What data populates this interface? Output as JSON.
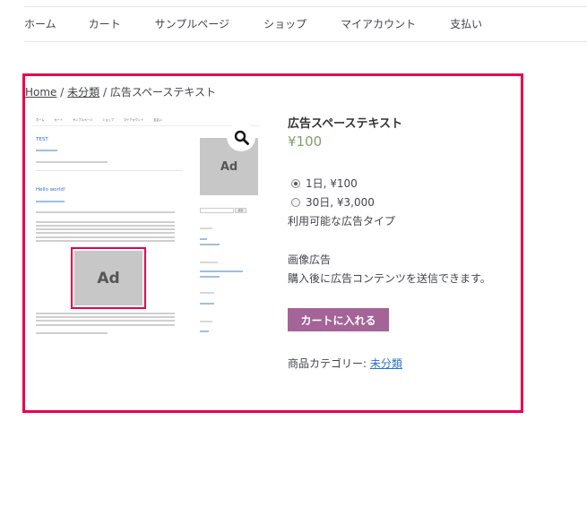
{
  "nav": {
    "items": [
      "ホーム",
      "カート",
      "サンプルページ",
      "ショップ",
      "マイアカウント",
      "支払い"
    ]
  },
  "breadcrumb": {
    "home": "Home",
    "category": "未分類",
    "current": "広告スペーステキスト",
    "separator": "/"
  },
  "gallery": {
    "mini_nav": [
      "ホーム",
      "カート",
      "サンプルページ",
      "ショップ",
      "マイアカウント",
      "支払い"
    ],
    "post1_title": "TEST",
    "post2_title": "Hello world!",
    "search_button": "検索",
    "ad_small": "Ad",
    "ad_big": "Ad",
    "zoom_icon": "search-icon"
  },
  "product": {
    "title": "広告スペーステキスト",
    "price": "¥100",
    "options": [
      {
        "label": "1日, ¥100",
        "checked": true
      },
      {
        "label": "30日, ¥3,000",
        "checked": false
      }
    ],
    "ad_types_label": "利用可能な広告タイプ",
    "ad_type": "画像広告",
    "ad_description": "購入後に広告コンテンツを送信できます。",
    "add_to_cart": "カートに入れる",
    "category_label": "商品カテゴリー:",
    "category_value": "未分類"
  },
  "colors": {
    "highlight": "#e8004d",
    "price": "#7f9f6f",
    "button": "#a46497",
    "link": "#2c74c9"
  }
}
